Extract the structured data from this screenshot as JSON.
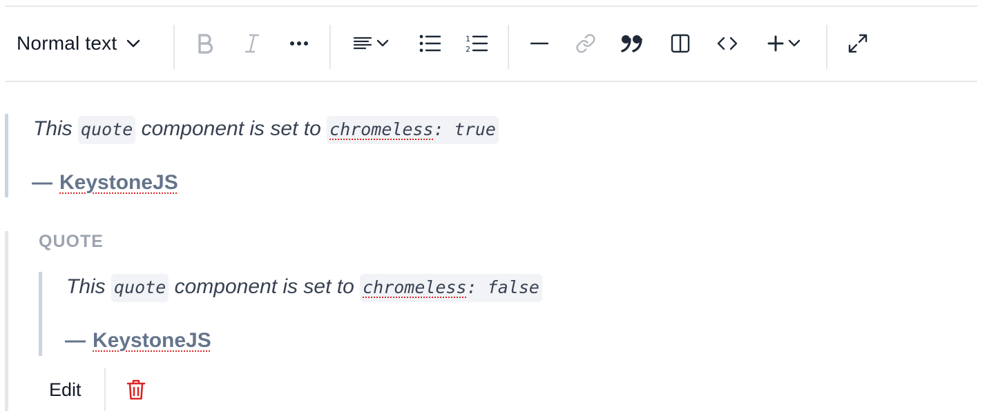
{
  "toolbar": {
    "block_type_label": "Normal text",
    "buttons": [
      {
        "name": "bold-button",
        "icon": "bold-icon"
      },
      {
        "name": "italic-button",
        "icon": "italic-icon"
      },
      {
        "name": "more-formatting-button",
        "icon": "more-horizontal-icon"
      },
      {
        "name": "alignment-dropdown",
        "icon": "align-left-icon"
      },
      {
        "name": "bullet-list-button",
        "icon": "bullet-list-icon"
      },
      {
        "name": "ordered-list-button",
        "icon": "ordered-list-icon"
      },
      {
        "name": "divider-button",
        "icon": "horizontal-rule-icon"
      },
      {
        "name": "link-button",
        "icon": "link-icon"
      },
      {
        "name": "quote-button",
        "icon": "quote-icon"
      },
      {
        "name": "layout-button",
        "icon": "columns-icon"
      },
      {
        "name": "code-block-button",
        "icon": "code-icon"
      },
      {
        "name": "insert-dropdown",
        "icon": "plus-icon"
      },
      {
        "name": "expand-button",
        "icon": "maximize-icon"
      }
    ]
  },
  "quote1": {
    "text_before": "This ",
    "code1": "quote",
    "text_mid": " component is set to ",
    "code2_word": "chromeless",
    "code2_rest": ": true",
    "dash": "—",
    "attribution": "KeystoneJS"
  },
  "quote2": {
    "block_label": "QUOTE",
    "text_before": "This ",
    "code1": "quote",
    "text_mid": " component is set to ",
    "code2_word": "chromeless",
    "code2_rest": ": false",
    "dash": "—",
    "attribution": "KeystoneJS",
    "edit_label": "Edit"
  },
  "colors": {
    "accent_border": "#cbd5e1",
    "attribution": "#64748b",
    "delete": "#dc2626",
    "code_bg": "#f1f3f6"
  }
}
